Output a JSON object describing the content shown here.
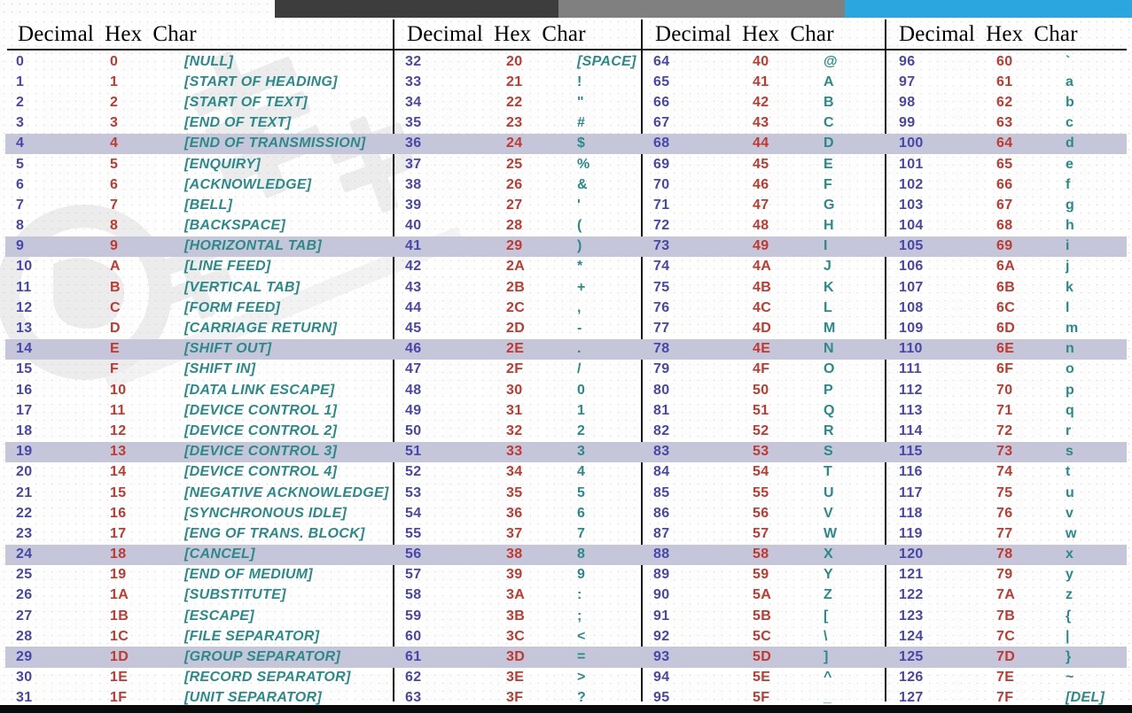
{
  "topbar": {
    "segments": [
      {
        "name": "dot-pattern",
        "color": "#fdfdfd"
      },
      {
        "name": "dark-gray",
        "color": "#3d3d3d"
      },
      {
        "name": "mid-gray",
        "color": "#808080"
      },
      {
        "name": "blue",
        "color": "#2ba6de"
      }
    ]
  },
  "colors": {
    "decimal": "#4846ab",
    "hex": "#c0392f",
    "char": "#2a8a8a",
    "highlight_row": "#c6c6da",
    "header": "#000000",
    "rule": "#101010"
  },
  "headers": {
    "decimal": "Decimal",
    "hex": "Hex",
    "char": "Char"
  },
  "columns": [
    {
      "rows": [
        {
          "dec": "0",
          "hex": "0",
          "chr": "[NULL]",
          "ctrl": true,
          "hl": false
        },
        {
          "dec": "1",
          "hex": "1",
          "chr": "[START OF HEADING]",
          "ctrl": true,
          "hl": false
        },
        {
          "dec": "2",
          "hex": "2",
          "chr": "[START OF TEXT]",
          "ctrl": true,
          "hl": false
        },
        {
          "dec": "3",
          "hex": "3",
          "chr": "[END OF TEXT]",
          "ctrl": true,
          "hl": false
        },
        {
          "dec": "4",
          "hex": "4",
          "chr": "[END OF TRANSMISSION]",
          "ctrl": true,
          "hl": true
        },
        {
          "dec": "5",
          "hex": "5",
          "chr": "[ENQUIRY]",
          "ctrl": true,
          "hl": false
        },
        {
          "dec": "6",
          "hex": "6",
          "chr": "[ACKNOWLEDGE]",
          "ctrl": true,
          "hl": false
        },
        {
          "dec": "7",
          "hex": "7",
          "chr": "[BELL]",
          "ctrl": true,
          "hl": false
        },
        {
          "dec": "8",
          "hex": "8",
          "chr": "[BACKSPACE]",
          "ctrl": true,
          "hl": false
        },
        {
          "dec": "9",
          "hex": "9",
          "chr": "[HORIZONTAL TAB]",
          "ctrl": true,
          "hl": true
        },
        {
          "dec": "10",
          "hex": "A",
          "chr": "[LINE FEED]",
          "ctrl": true,
          "hl": false
        },
        {
          "dec": "11",
          "hex": "B",
          "chr": "[VERTICAL TAB]",
          "ctrl": true,
          "hl": false
        },
        {
          "dec": "12",
          "hex": "C",
          "chr": "[FORM FEED]",
          "ctrl": true,
          "hl": false
        },
        {
          "dec": "13",
          "hex": "D",
          "chr": "[CARRIAGE RETURN]",
          "ctrl": true,
          "hl": false
        },
        {
          "dec": "14",
          "hex": "E",
          "chr": "[SHIFT OUT]",
          "ctrl": true,
          "hl": true
        },
        {
          "dec": "15",
          "hex": "F",
          "chr": "[SHIFT IN]",
          "ctrl": true,
          "hl": false
        },
        {
          "dec": "16",
          "hex": "10",
          "chr": "[DATA LINK ESCAPE]",
          "ctrl": true,
          "hl": false
        },
        {
          "dec": "17",
          "hex": "11",
          "chr": "[DEVICE CONTROL 1]",
          "ctrl": true,
          "hl": false
        },
        {
          "dec": "18",
          "hex": "12",
          "chr": "[DEVICE CONTROL 2]",
          "ctrl": true,
          "hl": false
        },
        {
          "dec": "19",
          "hex": "13",
          "chr": "[DEVICE CONTROL 3]",
          "ctrl": true,
          "hl": true
        },
        {
          "dec": "20",
          "hex": "14",
          "chr": "[DEVICE CONTROL 4]",
          "ctrl": true,
          "hl": false
        },
        {
          "dec": "21",
          "hex": "15",
          "chr": "[NEGATIVE ACKNOWLEDGE]",
          "ctrl": true,
          "hl": false
        },
        {
          "dec": "22",
          "hex": "16",
          "chr": "[SYNCHRONOUS IDLE]",
          "ctrl": true,
          "hl": false
        },
        {
          "dec": "23",
          "hex": "17",
          "chr": "[ENG OF TRANS. BLOCK]",
          "ctrl": true,
          "hl": false
        },
        {
          "dec": "24",
          "hex": "18",
          "chr": "[CANCEL]",
          "ctrl": true,
          "hl": true
        },
        {
          "dec": "25",
          "hex": "19",
          "chr": "[END OF MEDIUM]",
          "ctrl": true,
          "hl": false
        },
        {
          "dec": "26",
          "hex": "1A",
          "chr": "[SUBSTITUTE]",
          "ctrl": true,
          "hl": false
        },
        {
          "dec": "27",
          "hex": "1B",
          "chr": "[ESCAPE]",
          "ctrl": true,
          "hl": false
        },
        {
          "dec": "28",
          "hex": "1C",
          "chr": "[FILE SEPARATOR]",
          "ctrl": true,
          "hl": false
        },
        {
          "dec": "29",
          "hex": "1D",
          "chr": "[GROUP SEPARATOR]",
          "ctrl": true,
          "hl": true
        },
        {
          "dec": "30",
          "hex": "1E",
          "chr": "[RECORD SEPARATOR]",
          "ctrl": true,
          "hl": false
        },
        {
          "dec": "31",
          "hex": "1F",
          "chr": "[UNIT SEPARATOR]",
          "ctrl": true,
          "hl": false
        }
      ]
    },
    {
      "rows": [
        {
          "dec": "32",
          "hex": "20",
          "chr": "[SPACE]",
          "ctrl": true,
          "hl": false
        },
        {
          "dec": "33",
          "hex": "21",
          "chr": "!",
          "ctrl": false,
          "hl": false
        },
        {
          "dec": "34",
          "hex": "22",
          "chr": "\"",
          "ctrl": false,
          "hl": false
        },
        {
          "dec": "35",
          "hex": "23",
          "chr": "#",
          "ctrl": false,
          "hl": false
        },
        {
          "dec": "36",
          "hex": "24",
          "chr": "$",
          "ctrl": false,
          "hl": true
        },
        {
          "dec": "37",
          "hex": "25",
          "chr": "%",
          "ctrl": false,
          "hl": false
        },
        {
          "dec": "38",
          "hex": "26",
          "chr": "&",
          "ctrl": false,
          "hl": false
        },
        {
          "dec": "39",
          "hex": "27",
          "chr": "'",
          "ctrl": false,
          "hl": false
        },
        {
          "dec": "40",
          "hex": "28",
          "chr": "(",
          "ctrl": false,
          "hl": false
        },
        {
          "dec": "41",
          "hex": "29",
          "chr": ")",
          "ctrl": false,
          "hl": true
        },
        {
          "dec": "42",
          "hex": "2A",
          "chr": "*",
          "ctrl": false,
          "hl": false
        },
        {
          "dec": "43",
          "hex": "2B",
          "chr": "+",
          "ctrl": false,
          "hl": false
        },
        {
          "dec": "44",
          "hex": "2C",
          "chr": ",",
          "ctrl": false,
          "hl": false
        },
        {
          "dec": "45",
          "hex": "2D",
          "chr": "-",
          "ctrl": false,
          "hl": false
        },
        {
          "dec": "46",
          "hex": "2E",
          "chr": ".",
          "ctrl": false,
          "hl": true
        },
        {
          "dec": "47",
          "hex": "2F",
          "chr": "/",
          "ctrl": false,
          "hl": false
        },
        {
          "dec": "48",
          "hex": "30",
          "chr": "0",
          "ctrl": false,
          "hl": false
        },
        {
          "dec": "49",
          "hex": "31",
          "chr": "1",
          "ctrl": false,
          "hl": false
        },
        {
          "dec": "50",
          "hex": "32",
          "chr": "2",
          "ctrl": false,
          "hl": false
        },
        {
          "dec": "51",
          "hex": "33",
          "chr": "3",
          "ctrl": false,
          "hl": true
        },
        {
          "dec": "52",
          "hex": "34",
          "chr": "4",
          "ctrl": false,
          "hl": false
        },
        {
          "dec": "53",
          "hex": "35",
          "chr": "5",
          "ctrl": false,
          "hl": false
        },
        {
          "dec": "54",
          "hex": "36",
          "chr": "6",
          "ctrl": false,
          "hl": false
        },
        {
          "dec": "55",
          "hex": "37",
          "chr": "7",
          "ctrl": false,
          "hl": false
        },
        {
          "dec": "56",
          "hex": "38",
          "chr": "8",
          "ctrl": false,
          "hl": true
        },
        {
          "dec": "57",
          "hex": "39",
          "chr": "9",
          "ctrl": false,
          "hl": false
        },
        {
          "dec": "58",
          "hex": "3A",
          "chr": ":",
          "ctrl": false,
          "hl": false
        },
        {
          "dec": "59",
          "hex": "3B",
          "chr": ";",
          "ctrl": false,
          "hl": false
        },
        {
          "dec": "60",
          "hex": "3C",
          "chr": "<",
          "ctrl": false,
          "hl": false
        },
        {
          "dec": "61",
          "hex": "3D",
          "chr": "=",
          "ctrl": false,
          "hl": true
        },
        {
          "dec": "62",
          "hex": "3E",
          "chr": ">",
          "ctrl": false,
          "hl": false
        },
        {
          "dec": "63",
          "hex": "3F",
          "chr": "?",
          "ctrl": false,
          "hl": false
        }
      ]
    },
    {
      "rows": [
        {
          "dec": "64",
          "hex": "40",
          "chr": "@",
          "ctrl": false,
          "hl": false
        },
        {
          "dec": "65",
          "hex": "41",
          "chr": "A",
          "ctrl": false,
          "hl": false
        },
        {
          "dec": "66",
          "hex": "42",
          "chr": "B",
          "ctrl": false,
          "hl": false
        },
        {
          "dec": "67",
          "hex": "43",
          "chr": "C",
          "ctrl": false,
          "hl": false
        },
        {
          "dec": "68",
          "hex": "44",
          "chr": "D",
          "ctrl": false,
          "hl": true
        },
        {
          "dec": "69",
          "hex": "45",
          "chr": "E",
          "ctrl": false,
          "hl": false
        },
        {
          "dec": "70",
          "hex": "46",
          "chr": "F",
          "ctrl": false,
          "hl": false
        },
        {
          "dec": "71",
          "hex": "47",
          "chr": "G",
          "ctrl": false,
          "hl": false
        },
        {
          "dec": "72",
          "hex": "48",
          "chr": "H",
          "ctrl": false,
          "hl": false
        },
        {
          "dec": "73",
          "hex": "49",
          "chr": "I",
          "ctrl": false,
          "hl": true
        },
        {
          "dec": "74",
          "hex": "4A",
          "chr": "J",
          "ctrl": false,
          "hl": false
        },
        {
          "dec": "75",
          "hex": "4B",
          "chr": "K",
          "ctrl": false,
          "hl": false
        },
        {
          "dec": "76",
          "hex": "4C",
          "chr": "L",
          "ctrl": false,
          "hl": false
        },
        {
          "dec": "77",
          "hex": "4D",
          "chr": "M",
          "ctrl": false,
          "hl": false
        },
        {
          "dec": "78",
          "hex": "4E",
          "chr": "N",
          "ctrl": false,
          "hl": true
        },
        {
          "dec": "79",
          "hex": "4F",
          "chr": "O",
          "ctrl": false,
          "hl": false
        },
        {
          "dec": "80",
          "hex": "50",
          "chr": "P",
          "ctrl": false,
          "hl": false
        },
        {
          "dec": "81",
          "hex": "51",
          "chr": "Q",
          "ctrl": false,
          "hl": false
        },
        {
          "dec": "82",
          "hex": "52",
          "chr": "R",
          "ctrl": false,
          "hl": false
        },
        {
          "dec": "83",
          "hex": "53",
          "chr": "S",
          "ctrl": false,
          "hl": true
        },
        {
          "dec": "84",
          "hex": "54",
          "chr": "T",
          "ctrl": false,
          "hl": false
        },
        {
          "dec": "85",
          "hex": "55",
          "chr": "U",
          "ctrl": false,
          "hl": false
        },
        {
          "dec": "86",
          "hex": "56",
          "chr": "V",
          "ctrl": false,
          "hl": false
        },
        {
          "dec": "87",
          "hex": "57",
          "chr": "W",
          "ctrl": false,
          "hl": false
        },
        {
          "dec": "88",
          "hex": "58",
          "chr": "X",
          "ctrl": false,
          "hl": true
        },
        {
          "dec": "89",
          "hex": "59",
          "chr": "Y",
          "ctrl": false,
          "hl": false
        },
        {
          "dec": "90",
          "hex": "5A",
          "chr": "Z",
          "ctrl": false,
          "hl": false
        },
        {
          "dec": "91",
          "hex": "5B",
          "chr": "[",
          "ctrl": false,
          "hl": false
        },
        {
          "dec": "92",
          "hex": "5C",
          "chr": "\\",
          "ctrl": false,
          "hl": false
        },
        {
          "dec": "93",
          "hex": "5D",
          "chr": "]",
          "ctrl": false,
          "hl": true
        },
        {
          "dec": "94",
          "hex": "5E",
          "chr": "^",
          "ctrl": false,
          "hl": false
        },
        {
          "dec": "95",
          "hex": "5F",
          "chr": "_",
          "ctrl": false,
          "hl": false
        }
      ]
    },
    {
      "rows": [
        {
          "dec": "96",
          "hex": "60",
          "chr": "`",
          "ctrl": false,
          "hl": false
        },
        {
          "dec": "97",
          "hex": "61",
          "chr": "a",
          "ctrl": false,
          "hl": false
        },
        {
          "dec": "98",
          "hex": "62",
          "chr": "b",
          "ctrl": false,
          "hl": false
        },
        {
          "dec": "99",
          "hex": "63",
          "chr": "c",
          "ctrl": false,
          "hl": false
        },
        {
          "dec": "100",
          "hex": "64",
          "chr": "d",
          "ctrl": false,
          "hl": true
        },
        {
          "dec": "101",
          "hex": "65",
          "chr": "e",
          "ctrl": false,
          "hl": false
        },
        {
          "dec": "102",
          "hex": "66",
          "chr": "f",
          "ctrl": false,
          "hl": false
        },
        {
          "dec": "103",
          "hex": "67",
          "chr": "g",
          "ctrl": false,
          "hl": false
        },
        {
          "dec": "104",
          "hex": "68",
          "chr": "h",
          "ctrl": false,
          "hl": false
        },
        {
          "dec": "105",
          "hex": "69",
          "chr": "i",
          "ctrl": false,
          "hl": true
        },
        {
          "dec": "106",
          "hex": "6A",
          "chr": "j",
          "ctrl": false,
          "hl": false
        },
        {
          "dec": "107",
          "hex": "6B",
          "chr": "k",
          "ctrl": false,
          "hl": false
        },
        {
          "dec": "108",
          "hex": "6C",
          "chr": "l",
          "ctrl": false,
          "hl": false
        },
        {
          "dec": "109",
          "hex": "6D",
          "chr": "m",
          "ctrl": false,
          "hl": false
        },
        {
          "dec": "110",
          "hex": "6E",
          "chr": "n",
          "ctrl": false,
          "hl": true
        },
        {
          "dec": "111",
          "hex": "6F",
          "chr": "o",
          "ctrl": false,
          "hl": false
        },
        {
          "dec": "112",
          "hex": "70",
          "chr": "p",
          "ctrl": false,
          "hl": false
        },
        {
          "dec": "113",
          "hex": "71",
          "chr": "q",
          "ctrl": false,
          "hl": false
        },
        {
          "dec": "114",
          "hex": "72",
          "chr": "r",
          "ctrl": false,
          "hl": false
        },
        {
          "dec": "115",
          "hex": "73",
          "chr": "s",
          "ctrl": false,
          "hl": true
        },
        {
          "dec": "116",
          "hex": "74",
          "chr": "t",
          "ctrl": false,
          "hl": false
        },
        {
          "dec": "117",
          "hex": "75",
          "chr": "u",
          "ctrl": false,
          "hl": false
        },
        {
          "dec": "118",
          "hex": "76",
          "chr": "v",
          "ctrl": false,
          "hl": false
        },
        {
          "dec": "119",
          "hex": "77",
          "chr": "w",
          "ctrl": false,
          "hl": false
        },
        {
          "dec": "120",
          "hex": "78",
          "chr": "x",
          "ctrl": false,
          "hl": true
        },
        {
          "dec": "121",
          "hex": "79",
          "chr": "y",
          "ctrl": false,
          "hl": false
        },
        {
          "dec": "122",
          "hex": "7A",
          "chr": "z",
          "ctrl": false,
          "hl": false
        },
        {
          "dec": "123",
          "hex": "7B",
          "chr": "{",
          "ctrl": false,
          "hl": false
        },
        {
          "dec": "124",
          "hex": "7C",
          "chr": "|",
          "ctrl": false,
          "hl": false
        },
        {
          "dec": "125",
          "hex": "7D",
          "chr": "}",
          "ctrl": false,
          "hl": true
        },
        {
          "dec": "126",
          "hex": "7E",
          "chr": "~",
          "ctrl": false,
          "hl": false
        },
        {
          "dec": "127",
          "hex": "7F",
          "chr": "[DEL]",
          "ctrl": true,
          "hl": false
        }
      ]
    }
  ]
}
